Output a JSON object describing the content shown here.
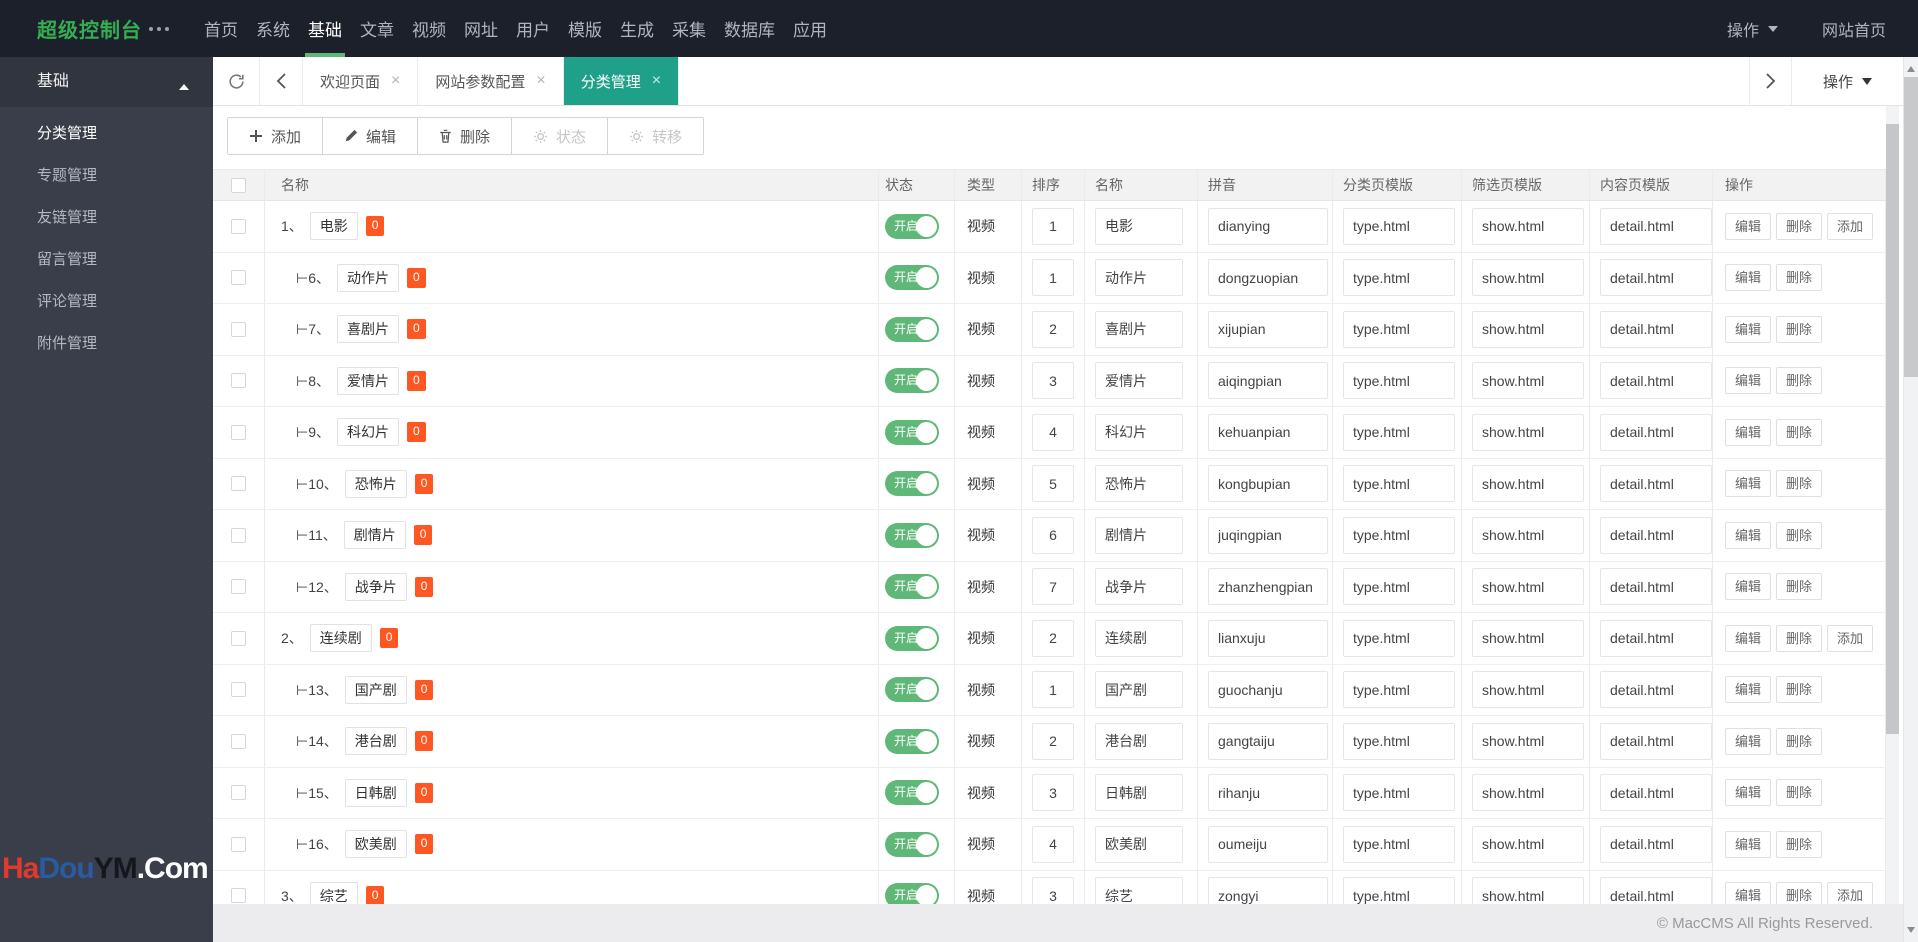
{
  "topbar": {
    "logo": "超级控制台",
    "nav": [
      {
        "label": "首页",
        "active": false
      },
      {
        "label": "系统",
        "active": false
      },
      {
        "label": "基础",
        "active": true
      },
      {
        "label": "文章",
        "active": false
      },
      {
        "label": "视频",
        "active": false
      },
      {
        "label": "网址",
        "active": false
      },
      {
        "label": "用户",
        "active": false
      },
      {
        "label": "模版",
        "active": false
      },
      {
        "label": "生成",
        "active": false
      },
      {
        "label": "采集",
        "active": false
      },
      {
        "label": "数据库",
        "active": false
      },
      {
        "label": "应用",
        "active": false
      }
    ],
    "ops_label": "操作",
    "home_label": "网站首页"
  },
  "sidebar": {
    "section_title": "基础",
    "items": [
      {
        "label": "分类管理",
        "active": true
      },
      {
        "label": "专题管理",
        "active": false
      },
      {
        "label": "友链管理",
        "active": false
      },
      {
        "label": "留言管理",
        "active": false
      },
      {
        "label": "评论管理",
        "active": false
      },
      {
        "label": "附件管理",
        "active": false
      }
    ],
    "watermark": {
      "part1": "Ha",
      "part2": "Dou",
      "part3": "YM",
      "part4": ".Com"
    }
  },
  "tabbar": {
    "tabs": [
      {
        "label": "欢迎页面",
        "active": false
      },
      {
        "label": "网站参数配置",
        "active": false
      },
      {
        "label": "分类管理",
        "active": true
      }
    ],
    "close_glyph": "×",
    "ops_label": "操作"
  },
  "toolbar": {
    "add": "添加",
    "edit": "编辑",
    "delete": "删除",
    "status": "状态",
    "transfer": "转移"
  },
  "table": {
    "columns": {
      "name": "名称",
      "status": "状态",
      "type": "类型",
      "sort": "排序",
      "name2": "名称",
      "pinyin": "拼音",
      "tpl_type": "分类页模版",
      "tpl_filter": "筛选页模版",
      "tpl_content": "内容页模版",
      "action": "操作"
    },
    "toggle_on_label": "开启",
    "action_labels": {
      "edit": "编辑",
      "delete": "删除",
      "add": "添加"
    },
    "rows": [
      {
        "prefix": "1、",
        "name": "电影",
        "badge": "0",
        "type": "视频",
        "sort": "1",
        "name2": "电影",
        "pinyin": "dianying",
        "tpl_type": "type.html",
        "tpl_filter": "show.html",
        "tpl_content": "detail.html",
        "child": false,
        "has_add": true
      },
      {
        "prefix": "⊢6、",
        "name": "动作片",
        "badge": "0",
        "type": "视频",
        "sort": "1",
        "name2": "动作片",
        "pinyin": "dongzuopian",
        "tpl_type": "type.html",
        "tpl_filter": "show.html",
        "tpl_content": "detail.html",
        "child": true,
        "has_add": false
      },
      {
        "prefix": "⊢7、",
        "name": "喜剧片",
        "badge": "0",
        "type": "视频",
        "sort": "2",
        "name2": "喜剧片",
        "pinyin": "xijupian",
        "tpl_type": "type.html",
        "tpl_filter": "show.html",
        "tpl_content": "detail.html",
        "child": true,
        "has_add": false
      },
      {
        "prefix": "⊢8、",
        "name": "爱情片",
        "badge": "0",
        "type": "视频",
        "sort": "3",
        "name2": "爱情片",
        "pinyin": "aiqingpian",
        "tpl_type": "type.html",
        "tpl_filter": "show.html",
        "tpl_content": "detail.html",
        "child": true,
        "has_add": false
      },
      {
        "prefix": "⊢9、",
        "name": "科幻片",
        "badge": "0",
        "type": "视频",
        "sort": "4",
        "name2": "科幻片",
        "pinyin": "kehuanpian",
        "tpl_type": "type.html",
        "tpl_filter": "show.html",
        "tpl_content": "detail.html",
        "child": true,
        "has_add": false
      },
      {
        "prefix": "⊢10、",
        "name": "恐怖片",
        "badge": "0",
        "type": "视频",
        "sort": "5",
        "name2": "恐怖片",
        "pinyin": "kongbupian",
        "tpl_type": "type.html",
        "tpl_filter": "show.html",
        "tpl_content": "detail.html",
        "child": true,
        "has_add": false
      },
      {
        "prefix": "⊢11、",
        "name": "剧情片",
        "badge": "0",
        "type": "视频",
        "sort": "6",
        "name2": "剧情片",
        "pinyin": "juqingpian",
        "tpl_type": "type.html",
        "tpl_filter": "show.html",
        "tpl_content": "detail.html",
        "child": true,
        "has_add": false
      },
      {
        "prefix": "⊢12、",
        "name": "战争片",
        "badge": "0",
        "type": "视频",
        "sort": "7",
        "name2": "战争片",
        "pinyin": "zhanzhengpian",
        "tpl_type": "type.html",
        "tpl_filter": "show.html",
        "tpl_content": "detail.html",
        "child": true,
        "has_add": false
      },
      {
        "prefix": "2、",
        "name": "连续剧",
        "badge": "0",
        "type": "视频",
        "sort": "2",
        "name2": "连续剧",
        "pinyin": "lianxuju",
        "tpl_type": "type.html",
        "tpl_filter": "show.html",
        "tpl_content": "detail.html",
        "child": false,
        "has_add": true
      },
      {
        "prefix": "⊢13、",
        "name": "国产剧",
        "badge": "0",
        "type": "视频",
        "sort": "1",
        "name2": "国产剧",
        "pinyin": "guochanju",
        "tpl_type": "type.html",
        "tpl_filter": "show.html",
        "tpl_content": "detail.html",
        "child": true,
        "has_add": false
      },
      {
        "prefix": "⊢14、",
        "name": "港台剧",
        "badge": "0",
        "type": "视频",
        "sort": "2",
        "name2": "港台剧",
        "pinyin": "gangtaiju",
        "tpl_type": "type.html",
        "tpl_filter": "show.html",
        "tpl_content": "detail.html",
        "child": true,
        "has_add": false
      },
      {
        "prefix": "⊢15、",
        "name": "日韩剧",
        "badge": "0",
        "type": "视频",
        "sort": "3",
        "name2": "日韩剧",
        "pinyin": "rihanju",
        "tpl_type": "type.html",
        "tpl_filter": "show.html",
        "tpl_content": "detail.html",
        "child": true,
        "has_add": false
      },
      {
        "prefix": "⊢16、",
        "name": "欧美剧",
        "badge": "0",
        "type": "视频",
        "sort": "4",
        "name2": "欧美剧",
        "pinyin": "oumeiju",
        "tpl_type": "type.html",
        "tpl_filter": "show.html",
        "tpl_content": "detail.html",
        "child": true,
        "has_add": false
      },
      {
        "prefix": "3、",
        "name": "综艺",
        "badge": "0",
        "type": "视频",
        "sort": "3",
        "name2": "综艺",
        "pinyin": "zongyi",
        "tpl_type": "type.html",
        "tpl_filter": "show.html",
        "tpl_content": "detail.html",
        "child": false,
        "has_add": true
      }
    ]
  },
  "footer": {
    "copyright": "© MacCMS All Rights Reserved."
  }
}
